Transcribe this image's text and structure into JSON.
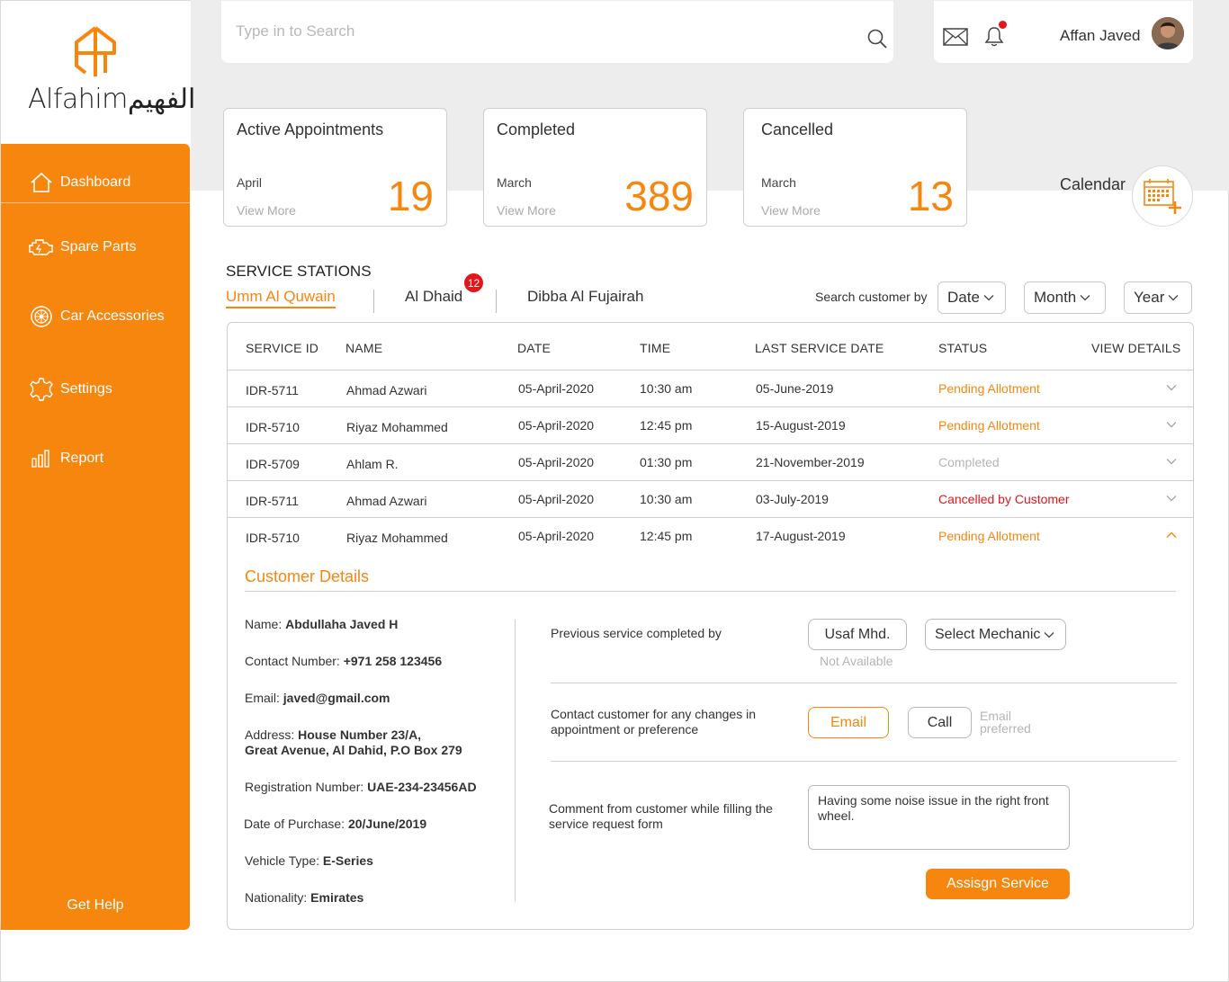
{
  "brand": {
    "name": "Alfahimالفهيم",
    "accent": "#f7860f"
  },
  "sidebar": {
    "items": [
      {
        "label": "Dashboard",
        "icon": "home-icon"
      },
      {
        "label": "Spare Parts",
        "icon": "engine-icon"
      },
      {
        "label": "Car Accessories",
        "icon": "wheel-icon"
      },
      {
        "label": "Settings",
        "icon": "gear-icon"
      },
      {
        "label": "Report",
        "icon": "bar-chart-icon"
      }
    ],
    "get_help": "Get Help"
  },
  "search": {
    "placeholder": "Type in to Search"
  },
  "user": {
    "name": "Affan Javed"
  },
  "stats": [
    {
      "title": "Active Appointments",
      "month": "April",
      "value": "19",
      "more": "View More"
    },
    {
      "title": "Completed",
      "month": "March",
      "value": "389",
      "more": "View More"
    },
    {
      "title": "Cancelled",
      "month": "March",
      "value": "13",
      "more": "View More"
    }
  ],
  "calendar_label": "Calendar",
  "stations": {
    "heading": "SERVICE STATIONS",
    "tabs": [
      "Umm Al Quwain",
      "Al Dhaid",
      "Dibba Al Fujairah"
    ],
    "badge": "12",
    "filter_label": "Search customer by",
    "filters": [
      "Date",
      "Month",
      "Year"
    ]
  },
  "table": {
    "headers": [
      "SERVICE ID",
      "NAME",
      "DATE",
      "TIME",
      "LAST SERVICE DATE",
      "STATUS",
      "VIEW DETAILS"
    ],
    "rows": [
      {
        "id": "IDR-5711",
        "name": "Ahmad Azwari",
        "date": "05-April-2020",
        "time": "10:30 am",
        "last": "05-June-2019",
        "status": "Pending Allotment"
      },
      {
        "id": "IDR-5710",
        "name": "Riyaz Mohammed",
        "date": "05-April-2020",
        "time": "12:45 pm",
        "last": "15-August-2019",
        "status": "Pending Allotment"
      },
      {
        "id": "IDR-5709",
        "name": "Ahlam R.",
        "date": "05-April-2020",
        "time": "01:30 pm",
        "last": "21-November-2019",
        "status": "Completed"
      },
      {
        "id": "IDR-5711",
        "name": "Ahmad Azwari",
        "date": "05-April-2020",
        "time": "10:30 am",
        "last": "03-July-2019",
        "status": "Cancelled by Customer"
      },
      {
        "id": "IDR-5710",
        "name": "Riyaz Mohammed",
        "date": "05-April-2020",
        "time": "12:45 pm",
        "last": "17-August-2019",
        "status": "Pending Allotment"
      }
    ]
  },
  "customer": {
    "title": "Customer Details",
    "name_label": "Name:",
    "name": "Abdullaha Javed H",
    "contact_label": "Contact Number:",
    "contact": "+971 258 123456",
    "email_label": "Email:",
    "email": "javed@gmail.com",
    "address_label": "Address:",
    "address_1": "House Number 23/A,",
    "address_2": "Great Avenue, Al Dahid, P.O Box 279",
    "reg_label": "Registration Number:",
    "reg": "UAE-234-23456AD",
    "purchase_label": "Date of Purchase:",
    "purchase": "20/June/2019",
    "vehicle_label": "Vehicle Type:",
    "vehicle": "E-Series",
    "nationality_label": "Nationality:",
    "nationality": "Emirates"
  },
  "assignment": {
    "prev_label": "Previous service completed by",
    "prev_mechanic": "Usaf Mhd.",
    "not_available": "Not Available",
    "select_mechanic": "Select Mechanic",
    "contact_label_1": "Contact customer for any changes in",
    "contact_label_2": "appointment or preference",
    "email_btn": "Email",
    "call_btn": "Call",
    "email_pref_1": "Email",
    "email_pref_2": "preferred",
    "comment_label_1": "Comment from customer while filling the",
    "comment_label_2": "service request form",
    "comment": "Having some noise issue in the right front wheel.",
    "assign_btn": "Assisgn Service"
  }
}
